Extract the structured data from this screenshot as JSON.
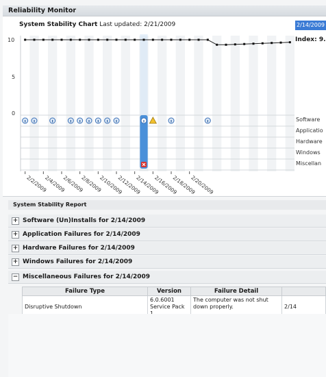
{
  "window": {
    "title": "Reliability Monitor"
  },
  "chart": {
    "title": "System Stability Chart",
    "updated": "Last updated: 2/21/2009",
    "selected_date": "2/14/2009",
    "index_label": "Index: 9.",
    "y_ticks": [
      "10",
      "5",
      "0"
    ],
    "row_labels": [
      "Software",
      "Applicatio",
      "Hardware",
      "Windows",
      "Miscellan"
    ],
    "date_labels": [
      "2/2/2009",
      "2/4/2009",
      "2/6/2009",
      "2/8/2009",
      "2/10/2009",
      "2/12/2009",
      "2/14/2009",
      "2/16/2009",
      "2/18/2009",
      "2/20/2009"
    ],
    "stability_index": [
      10,
      10,
      10,
      10,
      10,
      10,
      10,
      10,
      10,
      10,
      10,
      10,
      10,
      10,
      10,
      10,
      10,
      10,
      10,
      10,
      10,
      9.3,
      9.3,
      9.35,
      9.4,
      9.45,
      9.5,
      9.55,
      9.6,
      9.65
    ],
    "software_event_columns": [
      0,
      1,
      3,
      5,
      6,
      7,
      8,
      9,
      10,
      13,
      16,
      20
    ],
    "warning_column": 14,
    "error_column": 13,
    "selected_column": 13
  },
  "report": {
    "header": "System Stability Report",
    "sections": [
      {
        "label": "Software (Un)Installs for 2/14/2009",
        "toggle": "+"
      },
      {
        "label": "Application Failures for 2/14/2009",
        "toggle": "+"
      },
      {
        "label": "Hardware Failures for 2/14/2009",
        "toggle": "+"
      },
      {
        "label": "Windows Failures for 2/14/2009",
        "toggle": "+"
      },
      {
        "label": "Miscellaneous Failures for 2/14/2009",
        "toggle": "−"
      }
    ],
    "table": {
      "headers": [
        "Failure Type",
        "Version",
        "Failure Detail",
        ""
      ],
      "rows": [
        [
          "Disruptive Shutdown",
          "6.0.6001 Service Pack 1",
          "The computer was not shut down properly.",
          "2/14"
        ]
      ]
    }
  },
  "colors": {
    "accent": "#3a7bd5",
    "selection": "#4a90d9"
  }
}
